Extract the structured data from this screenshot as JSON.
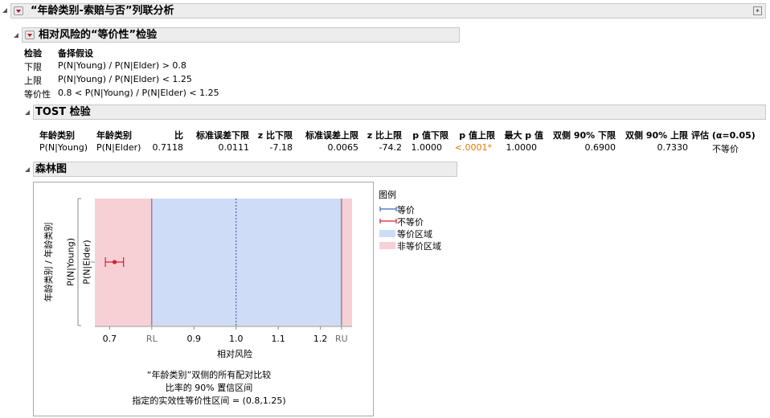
{
  "report": {
    "title": "“年龄类别-索赔与否”列联分析"
  },
  "rel_risk": {
    "title": "相对风险的“等价性”检验",
    "hyp_header_test": "检验",
    "hyp_header_alt": "备择假设",
    "hypotheses": [
      {
        "test": "下限",
        "alt": "P(N|Young) / P(N|Elder) > 0.8"
      },
      {
        "test": "上限",
        "alt": "P(N|Young) / P(N|Elder) < 1.25"
      },
      {
        "test": "等价性",
        "alt": "0.8 < P(N|Young) / P(N|Elder) < 1.25"
      }
    ]
  },
  "tost": {
    "title": "TOST 检验",
    "headers": [
      "年龄类别",
      "年龄类别",
      "比",
      "标准误差下限",
      "z 比下限",
      "标准误差上限",
      "z 比上限",
      "p 值下限",
      "p 值上限",
      "最大 p 值",
      "双侧 90% 下限",
      "双侧 90% 上限",
      "评估 (α=0.05)"
    ],
    "row": [
      "P(N|Young)",
      "P(N|Elder)",
      "0.7118",
      "0.0111",
      "-7.18",
      "0.0065",
      "-74.2",
      "1.0000",
      "<.0001*",
      "1.0000",
      "0.6900",
      "0.7330",
      "不等价"
    ],
    "highlight_color": "#e07a00"
  },
  "forest": {
    "title": "森林图",
    "y_label_outer": "年龄类别 / 年龄类别",
    "y_label_mid": "P(N|Young)",
    "y_label_inner": "P(N|Elder)",
    "x_label": "相对风险",
    "ticks": [
      "0.7",
      "RL",
      "0.9",
      "1.0",
      "1.1",
      "1.2",
      "RU"
    ],
    "caption_1": "“年龄类别”双侧的所有配对比较",
    "caption_2": "比率的 90% 置信区间",
    "caption_3": "指定的实效性等价性区间 = (0.8,1.25)",
    "legend_title": "图例",
    "legend": [
      {
        "label": "等价",
        "color": "#3a66c4"
      },
      {
        "label": "不等价",
        "color": "#d0223a"
      },
      {
        "label": "等价区域",
        "color": "#cfdcf7"
      },
      {
        "label": "非等价区域",
        "color": "#f7d0d6"
      }
    ]
  },
  "chart_data": {
    "type": "scatter",
    "xlabel": "相对风险",
    "ylabel": "年龄类别 / 年龄类别",
    "xlim": [
      0.665,
      1.275
    ],
    "categories": [
      "P(N|Elder)"
    ],
    "equivalence_region": [
      0.8,
      1.25
    ],
    "reference_line": 1.0,
    "points": [
      {
        "x": 0.7118,
        "lower": 0.69,
        "upper": 0.733
      }
    ]
  }
}
